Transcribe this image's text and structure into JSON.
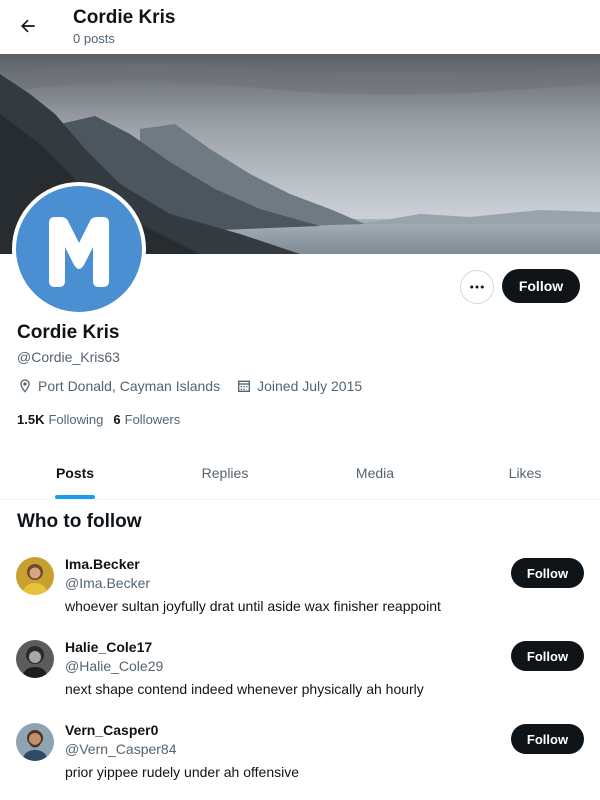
{
  "header": {
    "title": "Cordie Kris",
    "subtitle": "0 posts"
  },
  "profile": {
    "avatar_letter": "M",
    "avatar_color": "#4a8fd1",
    "name": "Cordie Kris",
    "handle": "@Cordie_Kris63",
    "location": "Port Donald, Cayman Islands",
    "joined": "Joined July 2015",
    "following_count": "1.5K",
    "following_label": "Following",
    "followers_count": "6",
    "followers_label": "Followers",
    "follow_label": "Follow"
  },
  "tabs": [
    "Posts",
    "Replies",
    "Media",
    "Likes"
  ],
  "who_to_follow": {
    "title": "Who to follow",
    "users": [
      {
        "name": "Ima.Becker",
        "handle": "@Ima.Becker",
        "bio": "whoever sultan joyfully drat until aside wax finisher reappoint",
        "follow_label": "Follow"
      },
      {
        "name": "Halie_Cole17",
        "handle": "@Halie_Cole29",
        "bio": "next shape contend indeed whenever physically ah hourly",
        "follow_label": "Follow"
      },
      {
        "name": "Vern_Casper0",
        "handle": "@Vern_Casper84",
        "bio": "prior yippee rudely under ah offensive",
        "follow_label": "Follow"
      }
    ]
  },
  "colors": {
    "accent": "#1d9bf0",
    "button_dark": "#0f1419",
    "muted_text": "#536471"
  }
}
